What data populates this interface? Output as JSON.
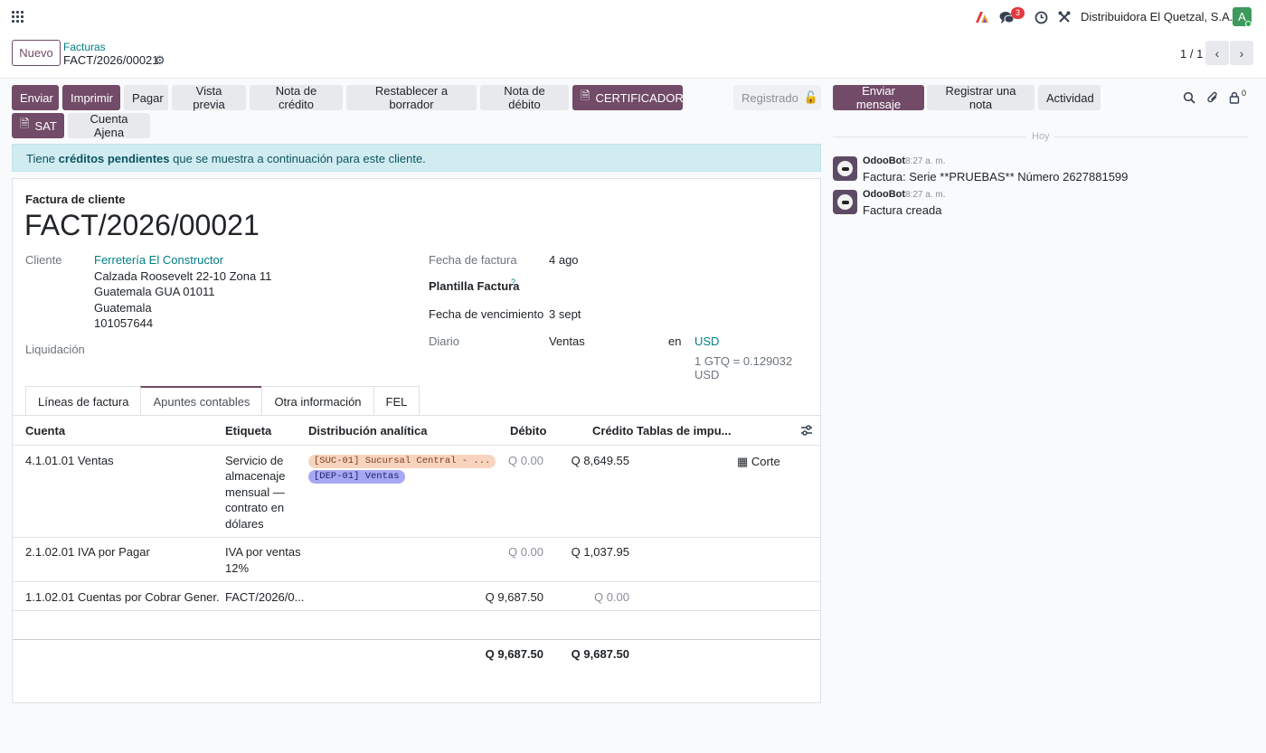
{
  "navbar": {
    "notification_count": "3",
    "company": "Distribuidora El Quetzal, S.A.",
    "avatar_letter": "A"
  },
  "breadcrumb": {
    "new_label": "Nuevo",
    "parent": "Facturas",
    "current": "FACT/2026/00021",
    "pager": "1 / 1"
  },
  "actions": {
    "send": "Enviar",
    "print": "Imprimir",
    "pay": "Pagar",
    "preview": "Vista previa",
    "credit_note": "Nota de crédito",
    "reset_draft": "Restablecer a borrador",
    "debit_note": "Nota de débito",
    "certifier": "CERTIFICADOR",
    "sat": "SAT",
    "foreign_account": "Cuenta Ajena",
    "status": "Registrado"
  },
  "alert": {
    "prefix": "Tiene",
    "bold": "créditos pendientes",
    "suffix": "que se muestra a continuación para este cliente."
  },
  "invoice": {
    "type_label": "Factura de cliente",
    "number": "FACT/2026/00021",
    "customer_label": "Cliente",
    "customer_name": "Ferretería El Constructor",
    "address_line1": "Calzada Roosevelt 22-10 Zona 11",
    "address_line2": "Guatemala GUA 01011",
    "address_line3": "Guatemala",
    "address_line4": "101057644",
    "liquidation_label": "Liquidación",
    "date_label": "Fecha de factura",
    "date_value": "4 ago",
    "template_label": "Plantilla Factura",
    "template_help": "?",
    "due_label": "Fecha de vencimiento",
    "due_value": "3 sept",
    "journal_label": "Diario",
    "journal_value": "Ventas",
    "in_label": "en",
    "currency": "USD",
    "rate": "1 GTQ = 0.129032 USD"
  },
  "tabs": [
    "Líneas de factura",
    "Apuntes contables",
    "Otra información",
    "FEL"
  ],
  "table": {
    "headers": {
      "account": "Cuenta",
      "label": "Etiqueta",
      "analytic": "Distribución analítica",
      "debit": "Débito",
      "credit": "Crédito",
      "taxes": "Tablas de impu..."
    },
    "rows": [
      {
        "account": "4.1.01.01 Ventas",
        "label_lines": [
          "Servicio de",
          "almacenaje",
          "mensual —",
          "contrato en",
          "dólares"
        ],
        "tag1": "[SUC-01] Sucursal Central - ...",
        "tag2": "[DEP-01] Ventas",
        "debit": "Q 0.00",
        "credit": "Q 8,649.55",
        "cutoff": "Corte"
      },
      {
        "account": "2.1.02.01 IVA por Pagar",
        "label_lines": [
          "IVA por ventas",
          "12%"
        ],
        "debit": "Q 0.00",
        "credit": "Q 1,037.95"
      },
      {
        "account": "1.1.02.01 Cuentas por Cobrar Gener...",
        "label_lines": [
          "FACT/2026/0..."
        ],
        "debit": "Q 9,687.50",
        "credit": "Q 0.00"
      }
    ],
    "total_debit": "Q 9,687.50",
    "total_credit": "Q 9,687.50"
  },
  "chatter": {
    "send_message": "Enviar mensaje",
    "log_note": "Registrar una nota",
    "activity": "Actividad",
    "follower_count": "0",
    "today": "Hoy",
    "messages": [
      {
        "author": "OdooBot",
        "time": "8:27 a. m.",
        "body": "Factura: Serie **PRUEBAS** Número 2627881599"
      },
      {
        "author": "OdooBot",
        "time": "8:27 a. m.",
        "body": "Factura creada"
      }
    ]
  },
  "colors": {
    "primary": "#714b67",
    "link": "#017e84",
    "alert_bg": "#d1ecf1",
    "tag_orange": "#f8d4bf",
    "tag_blue": "#a7a8f3"
  }
}
